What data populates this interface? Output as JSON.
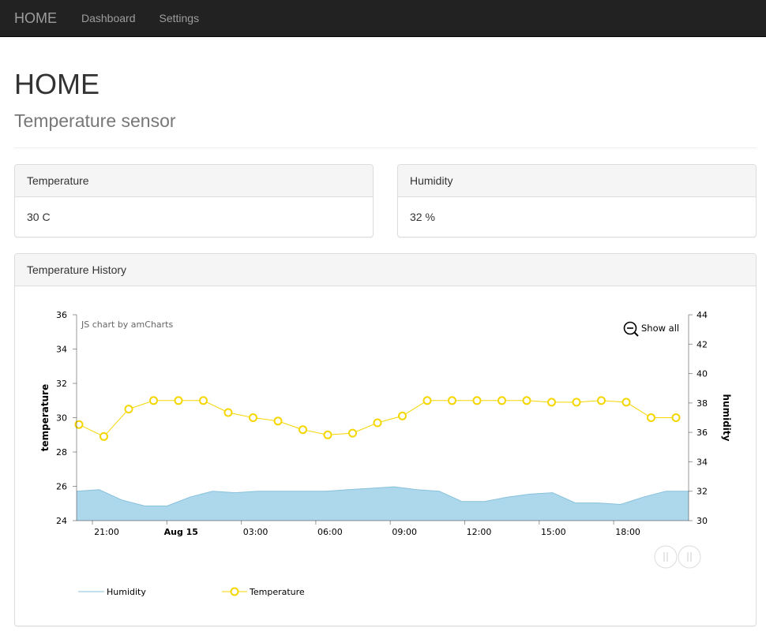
{
  "nav": {
    "brand": "HOME",
    "links": [
      "Dashboard",
      "Settings"
    ]
  },
  "page": {
    "title": "HOME",
    "subtitle": "Temperature sensor"
  },
  "panels": {
    "temperature": {
      "heading": "Temperature",
      "value": "30 C"
    },
    "humidity": {
      "heading": "Humidity",
      "value": "32 %"
    },
    "history": {
      "heading": "Temperature History"
    }
  },
  "chart": {
    "credit": "JS chart by amCharts",
    "show_all": "Show all",
    "legend": {
      "humidity": "Humidity",
      "temperature": "Temperature"
    },
    "colors": {
      "humidity_fill": "#add8eb",
      "humidity_line": "#87c1dc",
      "temperature": "#f5d600"
    }
  },
  "chart_data": {
    "type": "line",
    "x_ticks": [
      "21:00",
      "Aug 15",
      "03:00",
      "06:00",
      "09:00",
      "12:00",
      "15:00",
      "18:00"
    ],
    "y_left": {
      "label": "temperature",
      "ticks": [
        "24",
        "26",
        "28",
        "30",
        "32",
        "34",
        "36"
      ],
      "range": [
        24,
        36
      ]
    },
    "y_right": {
      "label": "humidity",
      "ticks": [
        "30",
        "32",
        "34",
        "36",
        "38",
        "40",
        "42",
        "44"
      ],
      "range": [
        30,
        44
      ]
    },
    "series": [
      {
        "name": "Temperature",
        "axis": "left",
        "values": [
          29.6,
          28.9,
          30.5,
          31.0,
          31.0,
          31.0,
          30.3,
          30.0,
          29.8,
          29.3,
          29.0,
          29.1,
          29.7,
          30.1,
          31.0,
          31.0,
          31.0,
          31.0,
          31.0,
          30.9,
          30.9,
          31.0,
          30.9,
          30.0,
          30.0
        ]
      },
      {
        "name": "Humidity",
        "axis": "right",
        "values": [
          32.0,
          32.1,
          31.4,
          31.0,
          31.0,
          31.6,
          32.0,
          31.9,
          32.0,
          32.0,
          32.0,
          32.0,
          32.1,
          32.2,
          32.3,
          32.1,
          32.0,
          31.3,
          31.3,
          31.6,
          31.8,
          31.9,
          31.2,
          31.2,
          31.1,
          31.6,
          32.0,
          32.0
        ]
      }
    ]
  }
}
